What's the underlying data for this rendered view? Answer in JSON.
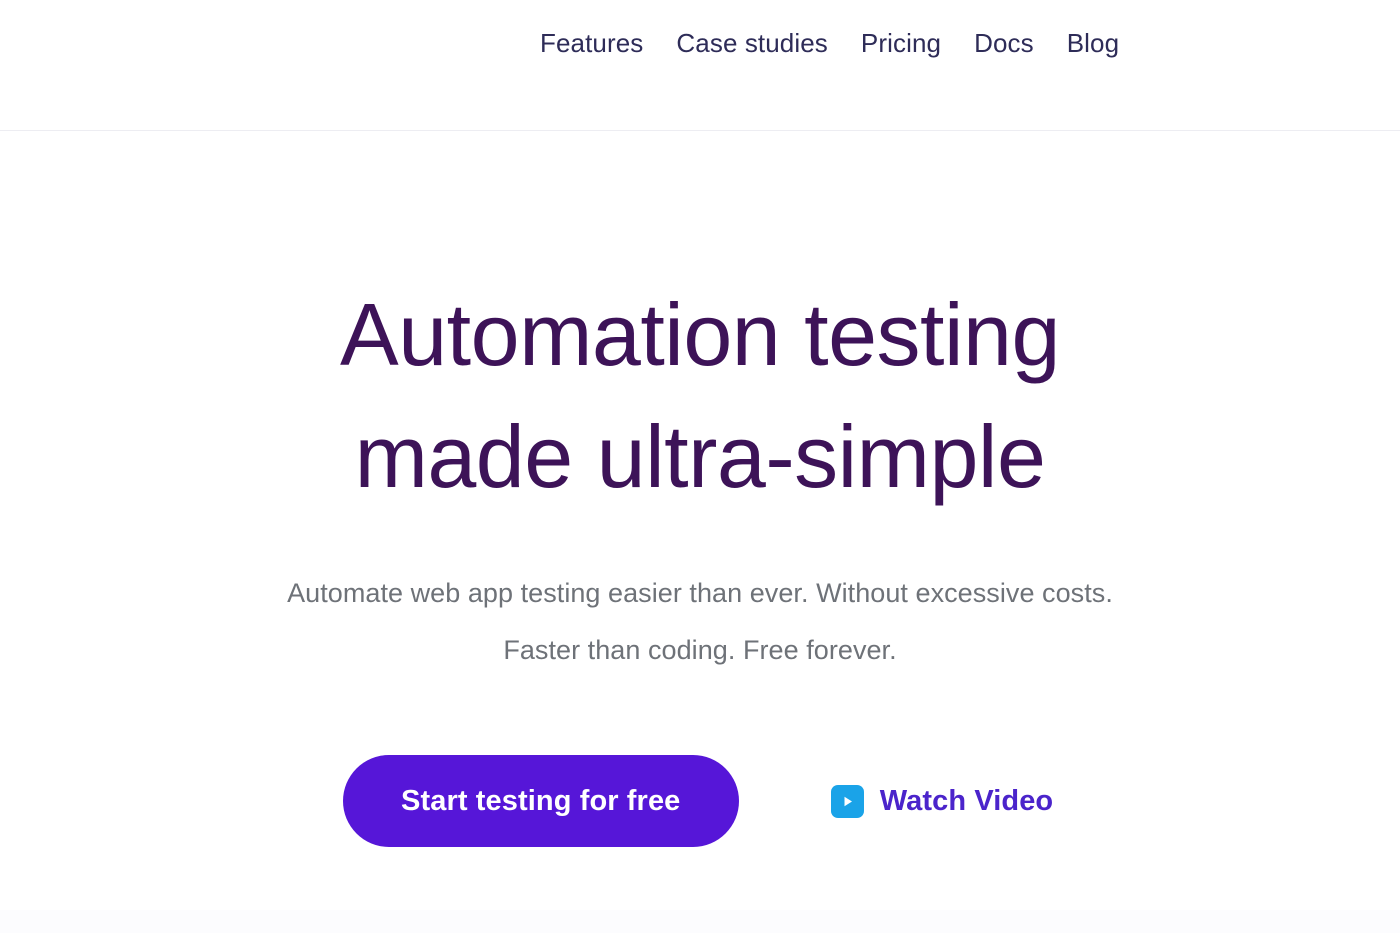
{
  "nav": {
    "items": [
      {
        "label": "Features"
      },
      {
        "label": "Case studies"
      },
      {
        "label": "Pricing"
      },
      {
        "label": "Docs"
      },
      {
        "label": "Blog"
      }
    ]
  },
  "hero": {
    "title_line_1": "Automation testing",
    "title_line_2": "made ultra-simple",
    "subtitle_line_1": "Automate web app testing easier than ever. Without excessive costs.",
    "subtitle_line_2": "Faster than coding. Free forever.",
    "cta_label": "Start testing for free",
    "watch_video_label": "Watch Video",
    "play_icon_name": "play-icon"
  },
  "colors": {
    "heading_purple": "#3d1358",
    "subtitle_gray": "#6e7278",
    "nav_text": "#2e2c58",
    "cta_purple": "#5616d8",
    "link_purple": "#4b24cb",
    "play_icon_blue": "#1aa3e8",
    "page_background": "#ffffff",
    "nav_border": "#ededf2"
  }
}
